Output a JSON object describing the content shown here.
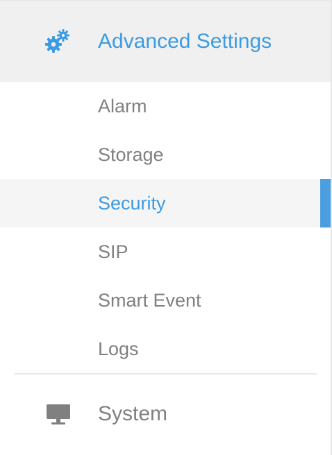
{
  "nav": {
    "advanced": {
      "icon": "gears-icon",
      "label": "Advanced Settings"
    },
    "submenu": [
      {
        "label": "Alarm",
        "active": false
      },
      {
        "label": "Storage",
        "active": false
      },
      {
        "label": "Security",
        "active": true
      },
      {
        "label": "SIP",
        "active": false
      },
      {
        "label": "Smart Event",
        "active": false
      },
      {
        "label": "Logs",
        "active": false
      }
    ],
    "system": {
      "icon": "monitor-icon",
      "label": "System"
    }
  },
  "colors": {
    "accent": "#3d9be2",
    "indicator": "#4b9fe1",
    "text_muted": "#808080",
    "header_bg": "#f0f0f0",
    "active_bg": "#f5f5f5"
  }
}
